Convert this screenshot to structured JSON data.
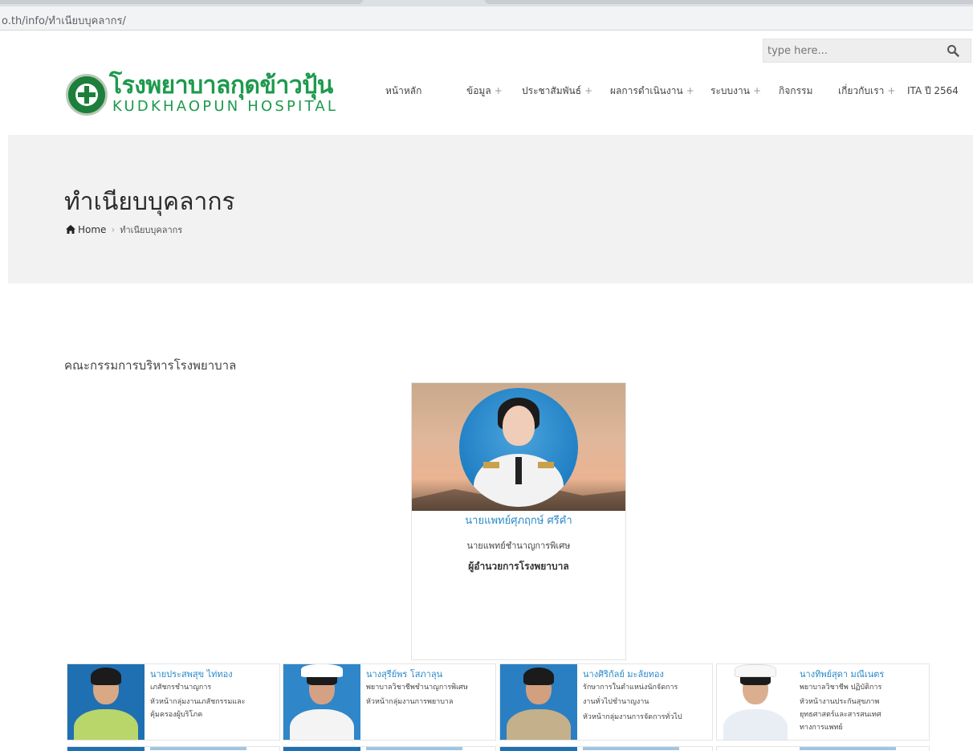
{
  "browser": {
    "url": "o.th/info/ทำเนียบบุคลากร/"
  },
  "search": {
    "placeholder": "type here..."
  },
  "logo": {
    "name_th": "โรงพยาบาลกุดข้าวปุ้น",
    "name_en": "KUDKHAOPUN HOSPITAL"
  },
  "nav": {
    "items": [
      {
        "label": "หน้าหลัก",
        "has_sub": false,
        "plus": ""
      },
      {
        "label": "ข้อมูล",
        "has_sub": true,
        "plus": "+"
      },
      {
        "label": "ประชาสัมพันธ์",
        "has_sub": true,
        "plus": "+"
      },
      {
        "label": "ผลการดำเนินงาน",
        "has_sub": true,
        "plus": "+"
      },
      {
        "label": "ระบบงาน",
        "has_sub": true,
        "plus": "+"
      },
      {
        "label": "กิจกรรม",
        "has_sub": false,
        "plus": ""
      },
      {
        "label": "เกี่ยวกับเรา",
        "has_sub": true,
        "plus": "+"
      },
      {
        "label": "ITA ปี 2564",
        "has_sub": false,
        "plus": ""
      }
    ]
  },
  "page": {
    "title": "ทำเนียบบุคลากร",
    "breadcrumb": {
      "home": "Home",
      "separator": "›",
      "current": "ทำเนียบบุคลากร"
    },
    "section_title": "คณะกรรมการบริหารโรงพยาบาล"
  },
  "director": {
    "name": "นายแพทย์ศุภฤกษ์ ศรีคำ",
    "position": "นายแพทย์ชำนาญการพิเศษ",
    "role": "ผู้อำนวยการโรงพยาบาล"
  },
  "staff": [
    {
      "name": "นายประสพสุข ไท่ทอง",
      "lines": [
        "เภสัชกรชำนาญการ",
        "หัวหน้ากลุ่มงานเภสัชกรรมและ",
        "คุ้มครองผู้บริโภค"
      ]
    },
    {
      "name": "นางสุรีย์พร โสภาลุน",
      "lines": [
        "พยาบาลวิชาชีพชำนาญการพิเศษ",
        "หัวหน้ากลุ่มงานการพยาบาล"
      ]
    },
    {
      "name": "นางศิริกัลย์ มะลัยทอง",
      "lines": [
        "รักษาการในตำแหน่งนักจัดการ",
        "งานทั่วไปชำนาญงาน",
        "หัวหน้ากลุ่มงานการจัดการทั่วไป"
      ]
    },
    {
      "name": "นางทิพย์สุดา มณีเนตร",
      "lines": [
        "พยาบาลวิชาชีพ ปฏิบัติการ",
        "หัวหน้างานประกันสุขภาพ",
        "ยุทธศาสตร์และสารสนเทศ",
        "ทางการแพทย์"
      ]
    }
  ],
  "colors": {
    "brand_green": "#1c9a4c",
    "link_blue": "#2a89c9",
    "band_gray": "#f2f2f2"
  }
}
